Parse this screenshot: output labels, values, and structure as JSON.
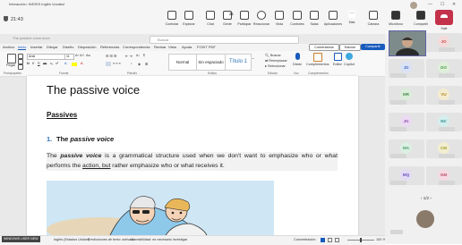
{
  "meeting": {
    "title": "Interacción: INDSIS Inglés Vocabul",
    "timer": "21:43"
  },
  "teams_toolbar": {
    "items": [
      {
        "label": "Controlar"
      },
      {
        "label": "Explorar"
      },
      {
        "label": "Chat"
      },
      {
        "label": "Gente",
        "count": "21"
      },
      {
        "label": "Participar"
      },
      {
        "label": "Reaccionar"
      },
      {
        "label": "Vista"
      },
      {
        "label": "Controles"
      },
      {
        "label": "Salas"
      },
      {
        "label": "Aplicaciones"
      },
      {
        "label": "Más"
      },
      {
        "label": "Cámara"
      },
      {
        "label": "Micrófono"
      },
      {
        "label": "Compartir"
      }
    ],
    "leave_label": "Salir"
  },
  "word": {
    "filename": "The passive voice.docx",
    "search_placeholder": "Buscar",
    "tabs": [
      "Archivo",
      "Inicio",
      "Insertar",
      "Dibujar",
      "Diseño",
      "Disposición",
      "Referencias",
      "Correspondencia",
      "Revisar",
      "Vista",
      "Ayuda",
      "FOXIT PDF"
    ],
    "active_tab": "Inicio",
    "comment_label": "Comentarios",
    "edit_label": "Edición",
    "share_label": "Compartir",
    "font_name": "Arial",
    "font_size": "11",
    "paste_label": "Pegar",
    "styles": [
      "Normal",
      "Sin espaciado",
      "Título 1"
    ],
    "editing_items": [
      "Buscar",
      "Reemplazar",
      "Seleccionar"
    ],
    "dictate_label": "Dictar",
    "addins_label": "Complementos",
    "editor_label": "Editor",
    "copilot_label": "Copilot",
    "groups": [
      "Portapapeles",
      "Fuente",
      "Párrafo",
      "Estilos",
      "Edición",
      "Voz",
      "Complementos"
    ]
  },
  "document": {
    "title": "The passive voice",
    "heading": "Passives",
    "section_number": "1.",
    "section_prefix": "The ",
    "section_emph": "passive voice",
    "para_start": "The ",
    "para_bi": "passive voice",
    "para_mid": " is a grammatical structure used when we don't want to emphasize who or what performs the ",
    "para_ul": "action, but",
    "para_end": " rather emphasize who or what receives it."
  },
  "statusbar": {
    "user": "WINDOWS USER NEW",
    "language": "Inglés (Estados Unidos)",
    "predictions": "Predicciones de texto: activado",
    "accessibility": "Accesibilidad: es necesario investigar",
    "focus": "Concentración",
    "zoom": "100 %"
  },
  "participants": [
    {
      "initials": "JO",
      "color": "#c94f4f"
    },
    {
      "initials": "JD",
      "color": "#4f6fc9"
    },
    {
      "initials": "DO",
      "color": "#4f9a4f"
    },
    {
      "initials": "MR",
      "color": "#4f8a4f"
    },
    {
      "initials": "VU",
      "color": "#b08a2a"
    },
    {
      "initials": "JG",
      "color": "#8a4fa8"
    },
    {
      "initials": "NC",
      "color": "#2f8a8a"
    },
    {
      "initials": "MA",
      "color": "#4f9a6a"
    },
    {
      "initials": "CM",
      "color": "#a89a2a"
    },
    {
      "initials": "MQ",
      "color": "#6a4fb8"
    },
    {
      "initials": "GM",
      "color": "#b84f6a"
    }
  ],
  "pager": "1/2",
  "colors": {
    "accent": "#185abd",
    "teams_purple": "#6264a7",
    "leave_red": "#c4314b",
    "section_blue": "#2e74b5"
  }
}
